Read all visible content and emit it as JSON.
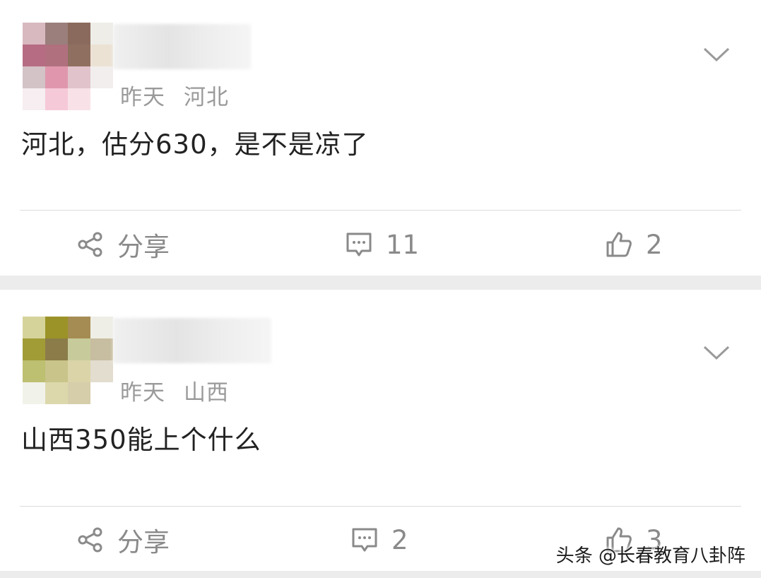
{
  "comments": [
    {
      "time": "昨天",
      "location": "河北",
      "text": "河北，估分630，是不是凉了",
      "share_label": "分享",
      "comment_count": "11",
      "like_count": "2",
      "avatar_colors": [
        "#d8b9c0",
        "#9a7f7c",
        "#8a6a5c",
        "#eeede8",
        "#b66c82",
        "#b0707e",
        "#8f7060",
        "#ece2d4",
        "#d3c2c6",
        "#e097ad",
        "#e1c3cc",
        "#f2eeee",
        "#f6eef0",
        "#f6c9d8",
        "#f8e2e8",
        "#ffffff"
      ]
    },
    {
      "time": "昨天",
      "location": "山西",
      "text": "山西350能上个什么",
      "share_label": "分享",
      "comment_count": "2",
      "like_count": "3",
      "avatar_colors": [
        "#d6d39a",
        "#9b9327",
        "#a58c53",
        "#efeee6",
        "#a29c36",
        "#8b7c49",
        "#c7cb9b",
        "#c7bda0",
        "#bdbf71",
        "#c9c48a",
        "#dbd4a8",
        "#e3ddcf",
        "#f1f2ea",
        "#dcd8ac",
        "#d6cdaa",
        "#ffffff"
      ]
    }
  ],
  "watermark": "头条 @长春教育八卦阵",
  "colors": {
    "meta": "#9a9a9a",
    "text": "#222222",
    "action": "#8a8a8a",
    "separator": "#ececec"
  },
  "icons": [
    "share-icon",
    "comment-icon",
    "like-icon",
    "chevron-down-icon"
  ]
}
